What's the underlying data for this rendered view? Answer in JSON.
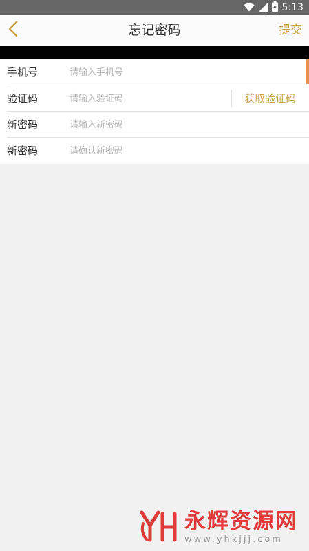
{
  "status_bar": {
    "time": "5:13"
  },
  "header": {
    "title": "忘记密码",
    "submit_label": "提交"
  },
  "form": {
    "rows": [
      {
        "label": "手机号",
        "placeholder": "请输入手机号"
      },
      {
        "label": "验证码",
        "placeholder": "请输入验证码",
        "action_label": "获取验证码"
      },
      {
        "label": "新密码",
        "placeholder": "请输入新密码"
      },
      {
        "label": "新密码",
        "placeholder": "请确认新密码"
      }
    ]
  },
  "watermark": {
    "logo_letters": "YH",
    "name": "永辉资源网",
    "url": "www.yhkjjj.com"
  },
  "colors": {
    "accent": "#c6a148",
    "status_bar": "#666666",
    "background": "#f1f1f1",
    "scroll_indicator": "#e8914a",
    "watermark_red": "#e13a3a"
  }
}
